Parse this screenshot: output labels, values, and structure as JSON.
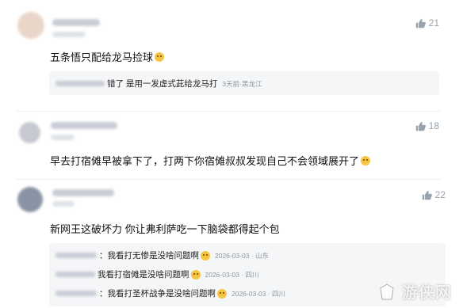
{
  "comments": [
    {
      "text": "五条悟只配给龙马捡球",
      "likes": "21",
      "replies": [
        {
          "text": "错了 是用一发虚式茈给龙马打",
          "meta": "3天前·黑龙江"
        }
      ]
    },
    {
      "text": "早去打宿傩早被拿下了，打两下你宿傩叔叔发现自己不会领域展开了",
      "likes": "18",
      "replies": []
    },
    {
      "text": "新网王这破坏力 你让弗利萨吃一下脑袋都得起个包",
      "likes": "22",
      "replies": [
        {
          "text": "：我看打无惨是没啥问题啊",
          "meta": "2026-03-03 · 山东"
        },
        {
          "text": "我看打宿傩是没啥问题啊",
          "meta": "2026-03-03 · 四川"
        },
        {
          "text": "：我看打圣杯战争是没啥问题啊",
          "meta": "2026-03-03 · 四川"
        }
      ]
    }
  ],
  "watermark": "游侠网",
  "icons": {
    "like": "thumbs-up-icon",
    "emoji": "smiley-emoji-icon"
  }
}
